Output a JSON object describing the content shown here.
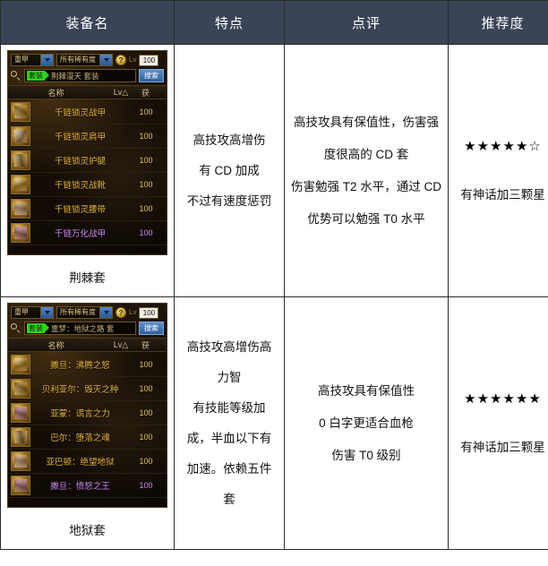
{
  "table": {
    "headers": [
      "装备名",
      "特点",
      "点评",
      "推荐度"
    ]
  },
  "rows": [
    {
      "screenshot": {
        "filters": {
          "armor_type": "重甲",
          "rarity": "所有稀有度",
          "help_icon": "question-mark-icon",
          "level_label": "Lv",
          "level_value": "100"
        },
        "search": {
          "icon": "search-icon",
          "tag": "套装",
          "query": "荆棘漫天 套装",
          "button": "搜索"
        },
        "list_headers": {
          "name": "名称",
          "level": "Lv△",
          "get": "获"
        },
        "items": [
          {
            "name": "千链锁灵战甲",
            "level": "100",
            "rare": false
          },
          {
            "name": "千链锁灵肩甲",
            "level": "100",
            "rare": false
          },
          {
            "name": "千链锁灵护腿",
            "level": "100",
            "rare": false
          },
          {
            "name": "千链锁灵战靴",
            "level": "100",
            "rare": false
          },
          {
            "name": "千链锁灵腰带",
            "level": "100",
            "rare": false
          },
          {
            "name": "千链万化战甲",
            "level": "100",
            "rare": true
          }
        ]
      },
      "caption": "荆棘套",
      "feature_lines": [
        "高技攻高增伤",
        "有 CD 加成",
        "不过有速度惩罚"
      ],
      "review_lines": [
        "高技攻具有保值性，伤害强",
        "度很高的 CD 套",
        "伤害勉强 T2 水平，通过 CD",
        "优势可以勉强 T0 水平"
      ],
      "rating_stars": "★★★★★☆",
      "rating_note": "有神话加三颗星"
    },
    {
      "screenshot": {
        "filters": {
          "armor_type": "重甲",
          "rarity": "所有稀有度",
          "help_icon": "question-mark-icon",
          "level_label": "Lv",
          "level_value": "100"
        },
        "search": {
          "icon": "search-icon",
          "tag": "套装",
          "query": "噩梦：地狱之路 套",
          "button": "搜索"
        },
        "list_headers": {
          "name": "名称",
          "level": "Lv△",
          "get": "获"
        },
        "items": [
          {
            "name": "撒旦：沸腾之怒",
            "level": "100",
            "rare": false
          },
          {
            "name": "贝利亚尔：毁灭之种",
            "level": "100",
            "rare": false
          },
          {
            "name": "亚蒙：谎言之力",
            "level": "100",
            "rare": false
          },
          {
            "name": "巴尔：堕落之魂",
            "level": "100",
            "rare": false
          },
          {
            "name": "亚巴顿：绝望地狱",
            "level": "100",
            "rare": false
          },
          {
            "name": "撒旦：愤怒之王",
            "level": "100",
            "rare": true
          }
        ]
      },
      "caption": "地狱套",
      "feature_lines": [
        "高技攻高增伤高",
        "力智",
        "有技能等级加",
        "成，半血以下有",
        "加速。依赖五件",
        "套"
      ],
      "review_lines": [
        "高技攻具有保值性",
        "0 白字更适合血枪",
        "伤害 T0 级别"
      ],
      "rating_stars": "★★★★★★",
      "rating_note": "有神话加三颗星"
    }
  ],
  "colors": {
    "header_bg": "#394456",
    "header_text": "#ffffff",
    "item_name": "#e8b53c",
    "item_name_rare": "#d08bf0",
    "tag_green": "#2fd41f",
    "button_blue": "#3b6ea8"
  }
}
